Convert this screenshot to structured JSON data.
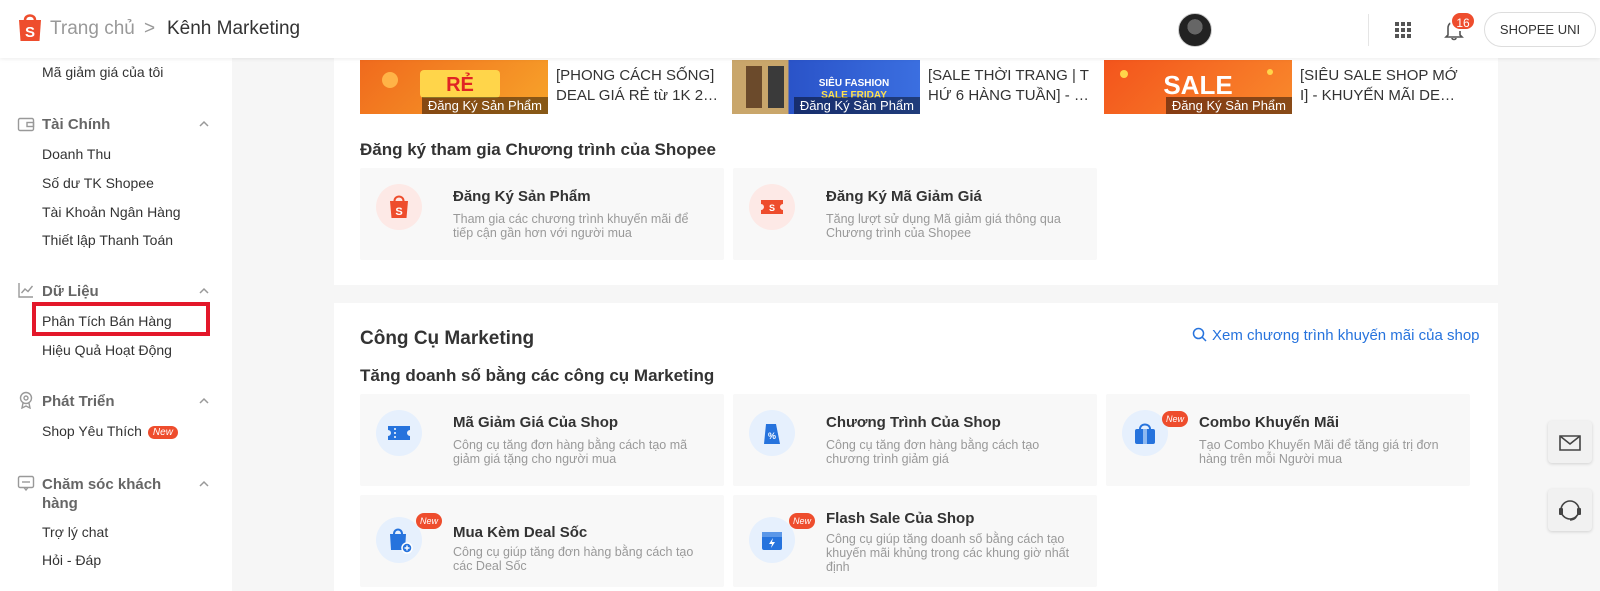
{
  "header": {
    "breadcrumb_home": "Trang chủ",
    "breadcrumb_sep": ">",
    "breadcrumb_current": "Kênh Marketing",
    "notification_count": "16",
    "uni_button": "SHOPEE UNI"
  },
  "sidebar": {
    "top_item": "Mã giảm giá của tôi",
    "finance": {
      "title": "Tài Chính",
      "items": [
        "Doanh Thu",
        "Số dư TK Shopee",
        "Tài Khoản Ngân Hàng",
        "Thiết lập Thanh Toán"
      ]
    },
    "data": {
      "title": "Dữ Liệu",
      "items": [
        "Phân Tích Bán Hàng",
        "Hiệu Quả Hoạt Động"
      ]
    },
    "growth": {
      "title": "Phát Triển",
      "items": [
        "Shop Yêu Thích"
      ],
      "new_tag": "New"
    },
    "care": {
      "title_line1": "Chăm sóc khách",
      "title_line2": "hàng",
      "items": [
        "Trợ lý chat",
        "Hỏi - Đáp"
      ]
    }
  },
  "banners": [
    {
      "label": "Đăng Ký Sản Phẩm",
      "title_line1": "[PHONG CÁCH SỐNG]",
      "title_line2": "DEAL GIÁ RẺ từ 1K 2…"
    },
    {
      "label": "Đăng Ký Sản Phẩm",
      "title_line1": "[SALE THỜI TRANG | T",
      "title_line2": "HỨ 6 HÀNG TUẦN] - …"
    },
    {
      "label": "Đăng Ký Sản Phẩm",
      "title_line1": "[SIÊU SALE SHOP MỚ",
      "title_line2": "I] - KHUYẾN MÃI DE…"
    }
  ],
  "register": {
    "title": "Đăng ký tham gia Chương trình của Shopee",
    "tiles": [
      {
        "title": "Đăng Ký Sản Phẩm",
        "desc": "Tham gia các chương trình khuyến mãi để tiếp cận gần hơn với người mua"
      },
      {
        "title": "Đăng Ký Mã Giảm Giá",
        "desc": "Tăng lượt sử dụng Mã giảm giá thông qua Chương trình của Shopee"
      }
    ]
  },
  "tools": {
    "title": "Công Cụ Marketing",
    "view_link": "Xem chương trình khuyến mãi của shop",
    "subtitle": "Tăng doanh số bằng các công cụ Marketing",
    "new_tag": "New",
    "tiles": [
      {
        "title": "Mã Giảm Giá Của Shop",
        "desc": "Công cụ tăng đơn hàng bằng cách tạo mã giảm giá tặng cho người mua"
      },
      {
        "title": "Chương Trình Của Shop",
        "desc": "Công cụ tăng đơn hàng bằng cách tạo chương trình giảm giá"
      },
      {
        "title": "Combo Khuyến Mãi",
        "desc": "Tạo Combo Khuyến Mãi để tăng giá trị đơn hàng trên mỗi Người mua"
      },
      {
        "title": "Mua Kèm Deal Sốc",
        "desc": "Công cụ giúp tăng đơn hàng bằng cách tạo các Deal Sốc"
      },
      {
        "title": "Flash Sale Của Shop",
        "desc": "Công cụ giúp tăng doanh số bằng cách tạo khuyến mãi khủng trong các khung giờ nhất định"
      }
    ]
  }
}
